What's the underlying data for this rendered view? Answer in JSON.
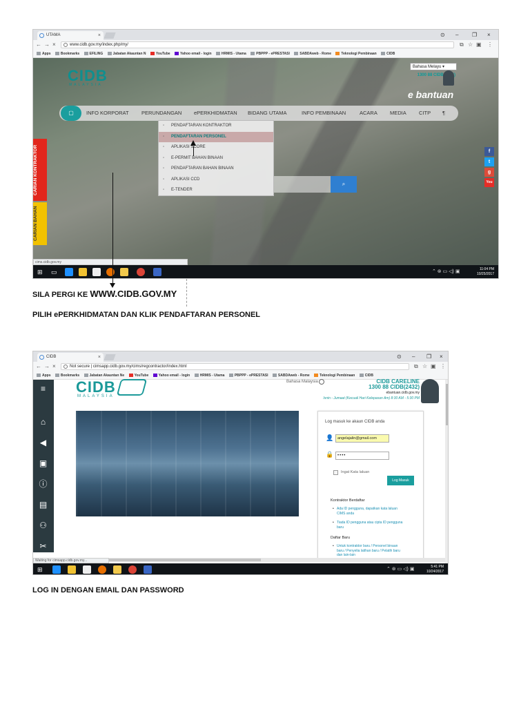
{
  "screenshot1": {
    "tab_title": "UTAMA",
    "url": "www.cidb.gov.my/index.php/my/",
    "bookmarks": [
      "Apps",
      "Bookmarks",
      "EFILING",
      "Jabatan Akauntan N",
      "YouTube",
      "Yahoo email - login",
      "HRMIS - Utama",
      "PBPPP - ePRESTASI",
      "SABDAweb - Rome",
      "Teknologi Pembinaan",
      "CIDB"
    ],
    "logo": "CIDB",
    "logo_sub": "MALAYSIA",
    "language": "Bahasa Melayu",
    "careline": [
      "1300 88 CIDB(2432)"
    ],
    "ebantuan": "e bantuan",
    "nav": [
      "INFO KORPORAT",
      "PERUNDANGAN",
      "ePERKHIDMATAN",
      "BIDANG UTAMA",
      "INFO PEMBINAAN",
      "ACARA",
      "MEDIA",
      "CITP"
    ],
    "dropdown": [
      "PENDAFTARAN KONTRAKTOR",
      "PENDAFTARAN PERSONEL",
      "APLIKASI SCORE",
      "E-PERMIT BAHAN BINAAN",
      "PENDAFTARAN BAHAN BINAAN",
      "APLIKASI CCD",
      "E-TENDER"
    ],
    "side_tabs": [
      "CARIAN KONTRAKTOR",
      "CARIAN BAHAN"
    ],
    "social": [
      "f",
      "t",
      "g",
      "You"
    ],
    "status_url": "cims.cidb.gov.my",
    "clock_time": "11:04 PM",
    "clock_date": "10/25/2017"
  },
  "screenshot2": {
    "tab_title": "CIDB",
    "url_prefix": "Not secure",
    "url": "cimsapp.cidb.gov.my/cims/regcontractor/index.html",
    "bookmarks": [
      "Apps",
      "Bookmarks",
      "Jabatan Akauntan Ne",
      "YouTube",
      "Yahoo email - login",
      "HRMIS - Utama",
      "PBPPP - ePRESTASI",
      "SABDAweb - Rome",
      "Teknologi Pembinaan",
      "CIDB"
    ],
    "logo": "CIDB",
    "logo_sub": "MALAYSIA",
    "language": "Bahasa Malaysia",
    "careline_title": "CIDB CARELINE",
    "careline_number": "1300 88 CIDB(2432)",
    "careline_email": "ebantuan.cidb.gov.my",
    "careline_hours": "Isnin - Jumaat (Kecuali Hari Kelepasan Am) 8:30 AM - 5:30 PM",
    "login": {
      "title": "Log masuk ke akaun CIDB anda",
      "email_value": "angelajalin@gmail.com",
      "password_value": "••••",
      "remember_label": "Ingat Kata laluan",
      "button_label": "Log Masuk",
      "section1_title": "Kontraktor Berdaftar",
      "section1_items": [
        "Ada ID pengguna, dapatkan kata laluan CIMS anda",
        "Tiada ID pengguna atau cipta ID pengguna baru"
      ],
      "section2_title": "Daftar Baru",
      "section2_items": [
        "Untuk kontraktor baru / Personel binaan baru / Penyelia latihan baru / Pelatih baru dan lain-lain"
      ]
    },
    "status_url": "Waiting for cimsapp.cidb.gov.my...",
    "clock_time": "5:41 PM",
    "clock_date": "10/24/2017"
  },
  "captions": {
    "line1_prefix": "SILA PERGI KE ",
    "line1_url": "WWW.CIDB.GOV.MY",
    "line2": "PILIH ePERKHIDMATAN DAN KLIK PENDAFTARAN PERSONEL",
    "line3": "LOG IN DENGAN EMAIL DAN PASSWORD"
  },
  "colors": {
    "teal": "#1a9e9e",
    "sidebar": "#2b3a40",
    "taskbar": "#101418",
    "highlight": "#c9a9a9"
  }
}
